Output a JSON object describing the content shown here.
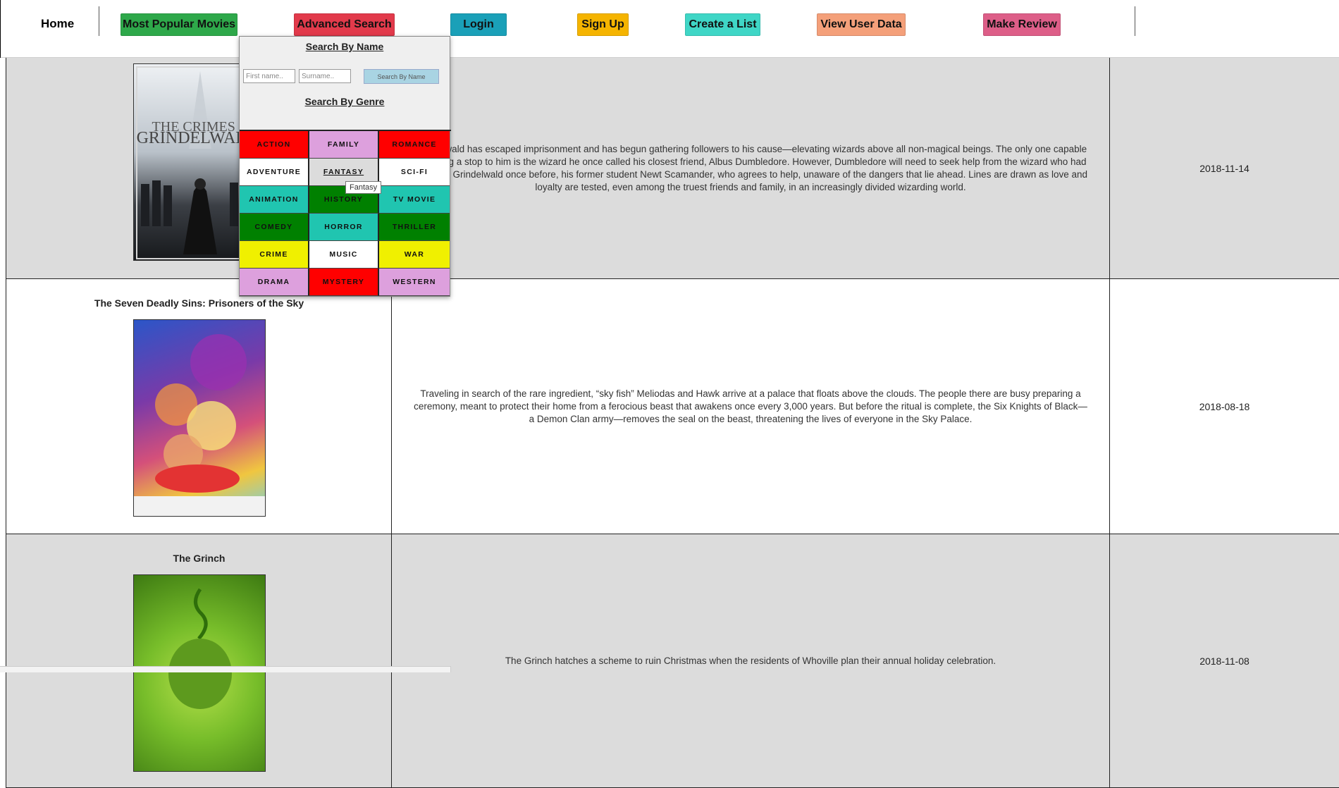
{
  "nav": {
    "home": "Home",
    "buttons": [
      {
        "label": "Most Popular Movies",
        "color": "#2ea84a"
      },
      {
        "label": "Advanced Search",
        "color": "#e23a4b"
      },
      {
        "label": "Login",
        "color": "#1aa0b8"
      },
      {
        "label": "Sign Up",
        "color": "#f5b400"
      },
      {
        "label": "Create a List",
        "color": "#3fd6c6"
      },
      {
        "label": "View User Data",
        "color": "#f4a07a"
      },
      {
        "label": "Make Review",
        "color": "#dd5e88"
      }
    ]
  },
  "search_dropdown": {
    "name_heading": "Search By Name",
    "first_name_placeholder": "First name..",
    "surname_placeholder": "Surname..",
    "search_button": "Search By Name",
    "genre_heading": "Search By Genre",
    "genres": [
      {
        "label": "ACTION",
        "color": "#ff0000"
      },
      {
        "label": "FAMILY",
        "color": "#dda0dd"
      },
      {
        "label": "ROMANCE",
        "color": "#ff0000"
      },
      {
        "label": "ADVENTURE",
        "color": "#ffffff"
      },
      {
        "label": "FANTASY",
        "color": "#dcdcdc"
      },
      {
        "label": "SCI-FI",
        "color": "#ffffff"
      },
      {
        "label": "ANIMATION",
        "color": "#20c5b0"
      },
      {
        "label": "HISTORY",
        "color": "#008000"
      },
      {
        "label": "TV MOVIE",
        "color": "#20c5b0"
      },
      {
        "label": "COMEDY",
        "color": "#008000"
      },
      {
        "label": "HORROR",
        "color": "#20c5b0"
      },
      {
        "label": "THRILLER",
        "color": "#008000"
      },
      {
        "label": "CRIME",
        "color": "#f0f000"
      },
      {
        "label": "MUSIC",
        "color": "#ffffff"
      },
      {
        "label": "WAR",
        "color": "#f0f000"
      },
      {
        "label": "DRAMA",
        "color": "#dda0dd"
      },
      {
        "label": "MYSTERY",
        "color": "#ff0000"
      },
      {
        "label": "WESTERN",
        "color": "#dda0dd"
      }
    ],
    "hovered_genre": "FANTASY",
    "tooltip": "Fantasy"
  },
  "movies": [
    {
      "title": "",
      "description": "Grindelwald has escaped imprisonment and has begun gathering followers to his cause—elevating wizards above all non-magical beings. The only one capable of putting a stop to him is the wizard he once called his closest friend, Albus Dumbledore. However, Dumbledore will need to seek help from the wizard who had thwarted Grindelwald once before, his former student Newt Scamander, who agrees to help, unaware of the dangers that lie ahead. Lines are drawn as love and loyalty are tested, even among the truest friends and family, in an increasingly divided wizarding world.",
      "date": "2018-11-14",
      "poster_icon": "crimes-of-grindelwald-poster"
    },
    {
      "title": "The Seven Deadly Sins: Prisoners of the Sky",
      "description": "Traveling in search of the rare ingredient, “sky fish” Meliodas and Hawk arrive at a palace that floats above the clouds. The people there are busy preparing a ceremony, meant to protect their home from a ferocious beast that awakens once every 3,000 years. But before the ritual is complete, the Six Knights of Black—a Demon Clan army—removes the seal on the beast, threatening the lives of everyone in the Sky Palace.",
      "date": "2018-08-18",
      "poster_icon": "seven-deadly-sins-poster"
    },
    {
      "title": "The Grinch",
      "description": "The Grinch hatches a scheme to ruin Christmas when the residents of Whoville plan their annual holiday celebration.",
      "date": "2018-11-08",
      "poster_icon": "grinch-poster"
    }
  ]
}
